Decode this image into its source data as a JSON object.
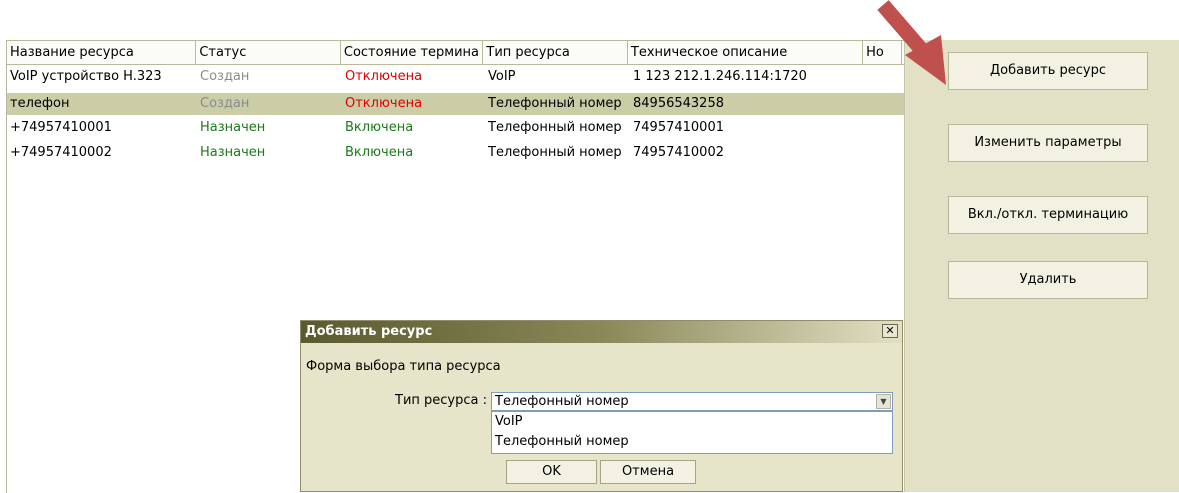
{
  "table": {
    "columns": [
      "Название ресурса",
      "Статус",
      "Состояние термина",
      "Тип ресурса",
      "Техническое описание",
      "Но"
    ],
    "rows": [
      {
        "name": "VoIP устройство H.323",
        "status": "Создан",
        "termination": "Отключена",
        "type": "VoIP",
        "description": "1 123 212.1.246.114:1720",
        "selected": false
      },
      {
        "name": "телефон",
        "status": "Создан",
        "termination": "Отключена",
        "type": "Телефонный номер",
        "description": "84956543258",
        "selected": true
      },
      {
        "name": "+74957410001",
        "status": "Назначен",
        "termination": "Включена",
        "type": "Телефонный номер",
        "description": "74957410001",
        "selected": false
      },
      {
        "name": "+74957410002",
        "status": "Назначен",
        "termination": "Включена",
        "type": "Телефонный номер",
        "description": "74957410002",
        "selected": false
      }
    ]
  },
  "side_buttons": {
    "add": "Добавить ресурс",
    "edit": "Изменить параметры",
    "toggle": "Вкл./откл. терминацию",
    "delete": "Удалить"
  },
  "dialog": {
    "title": "Добавить ресурс",
    "close_symbol": "✕",
    "subtitle": "Форма выбора типа ресурса",
    "field_label": "Тип ресурса :",
    "selected_value": "Телефонный номер",
    "options": [
      "VoIP",
      "Телефонный номер"
    ],
    "ok_label": "OK",
    "cancel_label": "Отмена"
  },
  "colors": {
    "arrow": "#c0504d",
    "status_created": "#8b8b8b",
    "status_assigned": "#1a7a1a",
    "termination_off": "#e00000",
    "termination_on": "#1a7a1a",
    "selected_row": "#cbcda6",
    "panel_bg": "#e3e1c5"
  }
}
